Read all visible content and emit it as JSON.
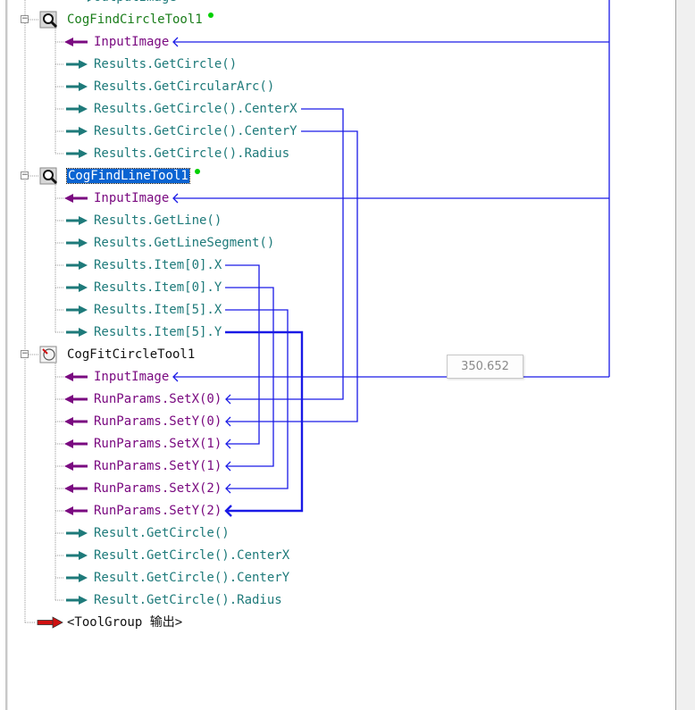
{
  "colors": {
    "input_link": "#7a0a80",
    "output_link": "#1e7a7a",
    "wire": "#1a1ae6",
    "tool_name": "#1a7d1a",
    "selection": "#0a64d2",
    "terminal_red": "#d01010"
  },
  "top_fragment": {
    "label": "OutputImage",
    "icon": "output-arrow-icon"
  },
  "tools": [
    {
      "name": "CogFindCircleTool1",
      "icon": "find-circle-tool-icon",
      "modified": true,
      "selected": false,
      "items": [
        {
          "label": "InputImage",
          "kind": "input"
        },
        {
          "label": "Results.GetCircle()",
          "kind": "output"
        },
        {
          "label": "Results.GetCircularArc()",
          "kind": "output"
        },
        {
          "label": "Results.GetCircle().CenterX",
          "kind": "output"
        },
        {
          "label": "Results.GetCircle().CenterY",
          "kind": "output"
        },
        {
          "label": "Results.GetCircle().Radius",
          "kind": "output"
        }
      ]
    },
    {
      "name": "CogFindLineTool1",
      "icon": "find-line-tool-icon",
      "modified": true,
      "selected": true,
      "items": [
        {
          "label": "InputImage",
          "kind": "input"
        },
        {
          "label": "Results.GetLine()",
          "kind": "output"
        },
        {
          "label": "Results.GetLineSegment()",
          "kind": "output"
        },
        {
          "label": "Results.Item[0].X",
          "kind": "output"
        },
        {
          "label": "Results.Item[0].Y",
          "kind": "output"
        },
        {
          "label": "Results.Item[5].X",
          "kind": "output"
        },
        {
          "label": "Results.Item[5].Y",
          "kind": "output"
        }
      ]
    },
    {
      "name": "CogFitCircleTool1",
      "icon": "fit-circle-tool-icon",
      "modified": false,
      "selected": false,
      "items": [
        {
          "label": "InputImage",
          "kind": "input"
        },
        {
          "label": "RunParams.SetX(0)",
          "kind": "input"
        },
        {
          "label": "RunParams.SetY(0)",
          "kind": "input"
        },
        {
          "label": "RunParams.SetX(1)",
          "kind": "input"
        },
        {
          "label": "RunParams.SetY(1)",
          "kind": "input"
        },
        {
          "label": "RunParams.SetX(2)",
          "kind": "input"
        },
        {
          "label": "RunParams.SetY(2)",
          "kind": "input"
        },
        {
          "label": "Result.GetCircle()",
          "kind": "output"
        },
        {
          "label": "Result.GetCircle().CenterX",
          "kind": "output"
        },
        {
          "label": "Result.GetCircle().CenterY",
          "kind": "output"
        },
        {
          "label": "Result.GetCircle().Radius",
          "kind": "output"
        }
      ]
    }
  ],
  "terminal": {
    "label": "<ToolGroup 输出>",
    "icon": "toolgroup-output-icon"
  },
  "tooltip": {
    "text": "350.652"
  }
}
